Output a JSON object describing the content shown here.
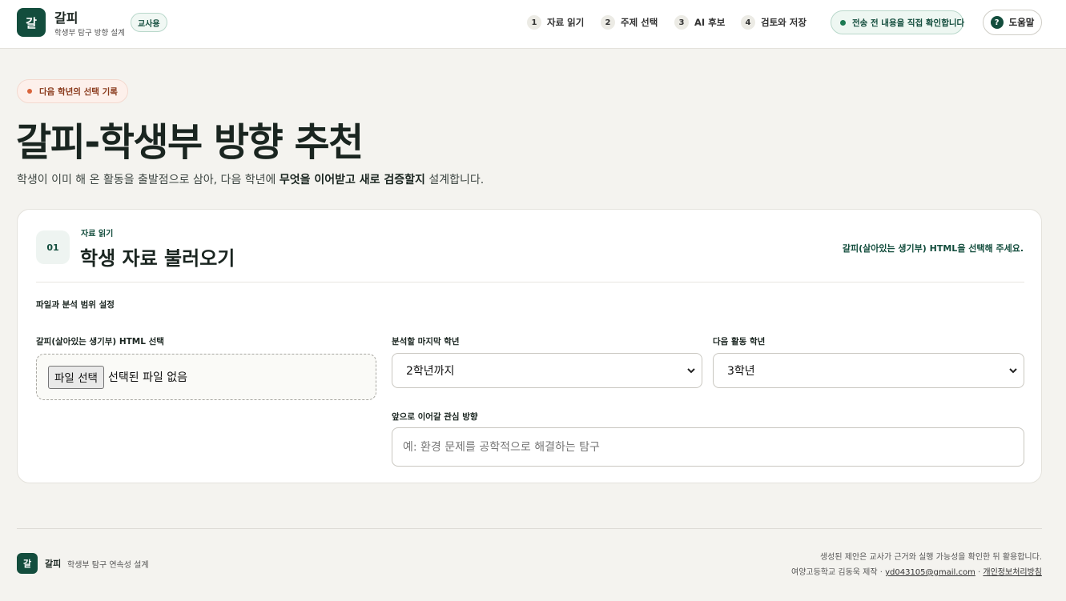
{
  "header": {
    "logo_char": "갈",
    "brand_name": "갈피",
    "brand_sub": "학생부 탐구 방향 설계",
    "role_badge": "교사용",
    "steps": [
      {
        "num": "1",
        "label": "자료 읽기"
      },
      {
        "num": "2",
        "label": "주제 선택"
      },
      {
        "num": "3",
        "label": "AI 후보"
      },
      {
        "num": "4",
        "label": "검토와 저장"
      }
    ],
    "confirm_notice": "전송 전 내용을 직접 확인합니다",
    "help_icon": "?",
    "help_label": "도움말"
  },
  "hero": {
    "eyebrow": "다음 학년의 선택 기록",
    "title": "갈피-학생부 방향 추천",
    "desc_prefix": "학생이 이미 해 온 활동을 출발점으로 삼아, 다음 학년에 ",
    "desc_bold": "무엇을 이어받고 새로 검증할지",
    "desc_suffix": " 설계합니다."
  },
  "card": {
    "step_num": "01",
    "kicker": "자료 읽기",
    "title": "학생 자료 불러오기",
    "hint": "갈피(살아있는 생기부) HTML을 선택해 주세요.",
    "section_label": "파일과 분석 범위 설정",
    "file_label": "갈피(살아있는 생기부) HTML 선택",
    "file_button": "파일 선택",
    "file_status": "선택된 파일 없음",
    "last_grade_label": "분석할 마지막 학년",
    "last_grade_value": "2학년까지",
    "next_grade_label": "다음 활동 학년",
    "next_grade_value": "3학년",
    "interest_label": "앞으로 이어갈 관심 방향",
    "interest_placeholder": "예: 환경 문제를 공학적으로 해결하는 탐구"
  },
  "footer": {
    "logo_char": "갈",
    "name": "갈피",
    "sub": "학생부 탐구 연속성 설계",
    "note": "생성된 제안은 교사가 근거와 실행 가능성을 확인한 뒤 활용합니다.",
    "maker": "여양고등학교 김동욱 제작 · ",
    "email": "yd043105@gmail.com",
    "sep": " · ",
    "privacy": "개인정보처리방침"
  },
  "colors": {
    "brand": "#134d3d",
    "background": "#f4f3ef",
    "accent_orange": "#d9643b"
  }
}
